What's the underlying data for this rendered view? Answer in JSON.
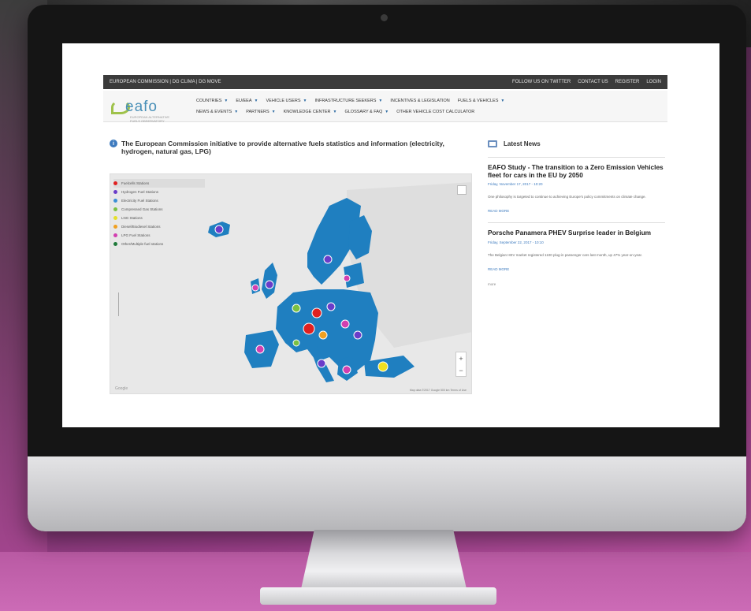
{
  "site": {
    "logo_text": "eafo",
    "logo_sub": "EUROPEAN ALTERNATIVE FUELS OBSERVATORY",
    "topbar_left": "EUROPEAN COMMISSION | DG CLIMA | DG MOVE",
    "topbar_right": [
      "FOLLOW US ON TWITTER",
      "CONTACT US",
      "REGISTER",
      "LOGIN"
    ]
  },
  "nav": {
    "row1": [
      "COUNTRIES",
      "EU/EEA",
      "VEHICLE USERS",
      "INFRASTRUCTURE SEEKERS",
      "INCENTIVES & LEGISLATION",
      "FUELS & VEHICLES"
    ],
    "row2": [
      "NEWS & EVENTS",
      "PARTNERS",
      "KNOWLEDGE CENTER",
      "GLOSSARY & FAQ",
      "OTHER VEHICLE COST CALCULATOR"
    ]
  },
  "intro": {
    "info_icon": "i",
    "title": "The European Commission initiative to provide alternative fuels statistics and information (electricity, hydrogen, natural gas, LPG)"
  },
  "map": {
    "legend": [
      {
        "label": "Fuelcells Stations",
        "color": "#e02020"
      },
      {
        "label": "Hydrogen Fuel Stations",
        "color": "#6a3cc9"
      },
      {
        "label": "Electricity Fuel Stations",
        "color": "#3b8fd6"
      },
      {
        "label": "Compressed Gas Stations",
        "color": "#7bc043"
      },
      {
        "label": "LNG Stations",
        "color": "#e6e02a"
      },
      {
        "label": "Diesel/Biodiesel Stations",
        "color": "#f0a020"
      },
      {
        "label": "LPG Fuel Stations",
        "color": "#d23fb0"
      },
      {
        "label": "Other/Multiple fuel stations",
        "color": "#1f7a3a"
      }
    ],
    "zoom_in": "+",
    "zoom_out": "−",
    "attribution": "Map data ©2017 Google  500 km  Terms of Use",
    "watermark": "Google"
  },
  "news": {
    "header": "Latest News",
    "items": [
      {
        "title": "EAFO Study - The transition to a Zero Emission Vehicles fleet for cars in the EU by 2050",
        "date": "Friday, November 17, 2017 - 10:20",
        "body": "One philosophy is targeted to continue to achieving Europe's policy commitments on climate change.",
        "read_more": "READ MORE"
      },
      {
        "title": "Porsche Panamera PHEV Surprise leader in Belgium",
        "date": "Friday, September 22, 2017 - 10:10",
        "body": "The Belgian HEV market registered 1100 plug-in passenger cars last month, up 47% year-on-year.",
        "read_more": "READ MORE"
      }
    ],
    "more": "more"
  }
}
